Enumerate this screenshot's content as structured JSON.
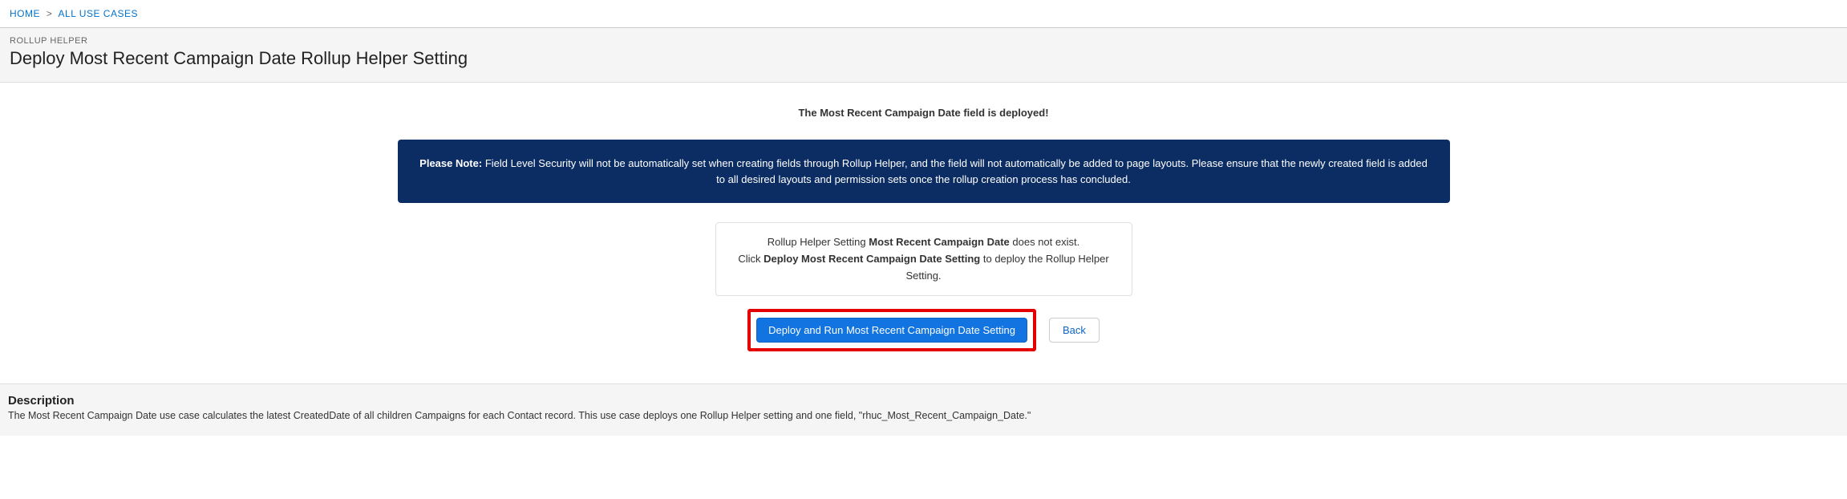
{
  "breadcrumbs": {
    "home": "HOME",
    "all_use_cases": "ALL USE CASES"
  },
  "header": {
    "eyebrow": "ROLLUP HELPER",
    "title": "Deploy Most Recent Campaign Date Rollup Helper Setting"
  },
  "content": {
    "deployed_msg": "The Most Recent Campaign Date field is deployed!",
    "note_prefix": "Please Note:",
    "note_body": " Field Level Security will not be automatically set when creating fields through Rollup Helper, and the field will not automatically be added to page layouts. Please ensure that the newly created field is added to all desired layouts and permission sets once the rollup creation process has concluded.",
    "detail_line1_pre": "Rollup Helper Setting ",
    "detail_line1_bold": "Most Recent Campaign Date",
    "detail_line1_post": " does not exist.",
    "detail_line2_pre": "Click ",
    "detail_line2_bold": "Deploy Most Recent Campaign Date Setting",
    "detail_line2_post": " to deploy the Rollup Helper Setting.",
    "deploy_btn": "Deploy and Run Most Recent Campaign Date Setting",
    "back_btn": "Back"
  },
  "description": {
    "heading": "Description",
    "body": "The Most Recent Campaign Date use case calculates the latest CreatedDate of all children Campaigns for each Contact record. This use case deploys one Rollup Helper setting and one field, \"rhuc_Most_Recent_Campaign_Date.\""
  }
}
